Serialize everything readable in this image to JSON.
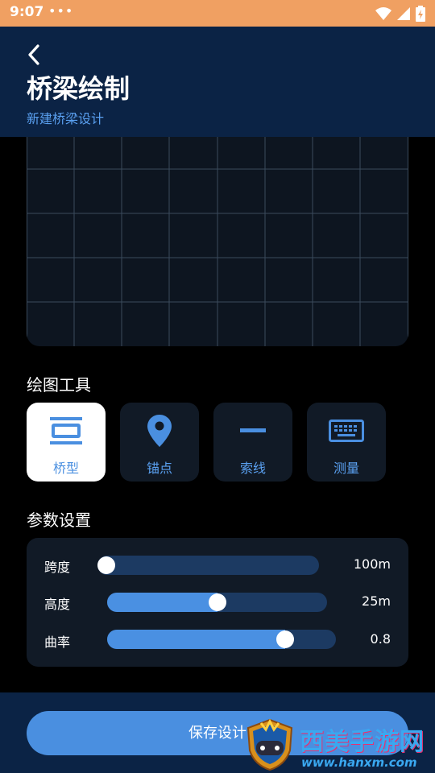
{
  "status_bar": {
    "time": "9:07",
    "more": "•••"
  },
  "header": {
    "title": "桥梁绘制",
    "subtitle": "新建桥梁设计"
  },
  "tools": {
    "title": "绘图工具",
    "items": [
      {
        "label": "桥型",
        "icon": "bridge-type-icon",
        "active": true
      },
      {
        "label": "锚点",
        "icon": "location-pin-icon",
        "active": false
      },
      {
        "label": "索线",
        "icon": "line-icon",
        "active": false
      },
      {
        "label": "测量",
        "icon": "keyboard-icon",
        "active": false
      }
    ]
  },
  "params": {
    "title": "参数设置",
    "items": [
      {
        "label": "跨度",
        "value": "100m",
        "level": 0.0
      },
      {
        "label": "高度",
        "value": "25m",
        "level": 0.5
      },
      {
        "label": "曲率",
        "value": "0.8",
        "level": 0.8
      }
    ]
  },
  "save_label": "保存设计",
  "watermark": {
    "text": "西美手游网",
    "url": "www.hanxm.com"
  },
  "colors": {
    "accent": "#4a90e2",
    "header_bg": "#0b2345",
    "status_bar": "#f0a062",
    "card_bg": "#111a26",
    "track_bg": "#1c3a62"
  }
}
